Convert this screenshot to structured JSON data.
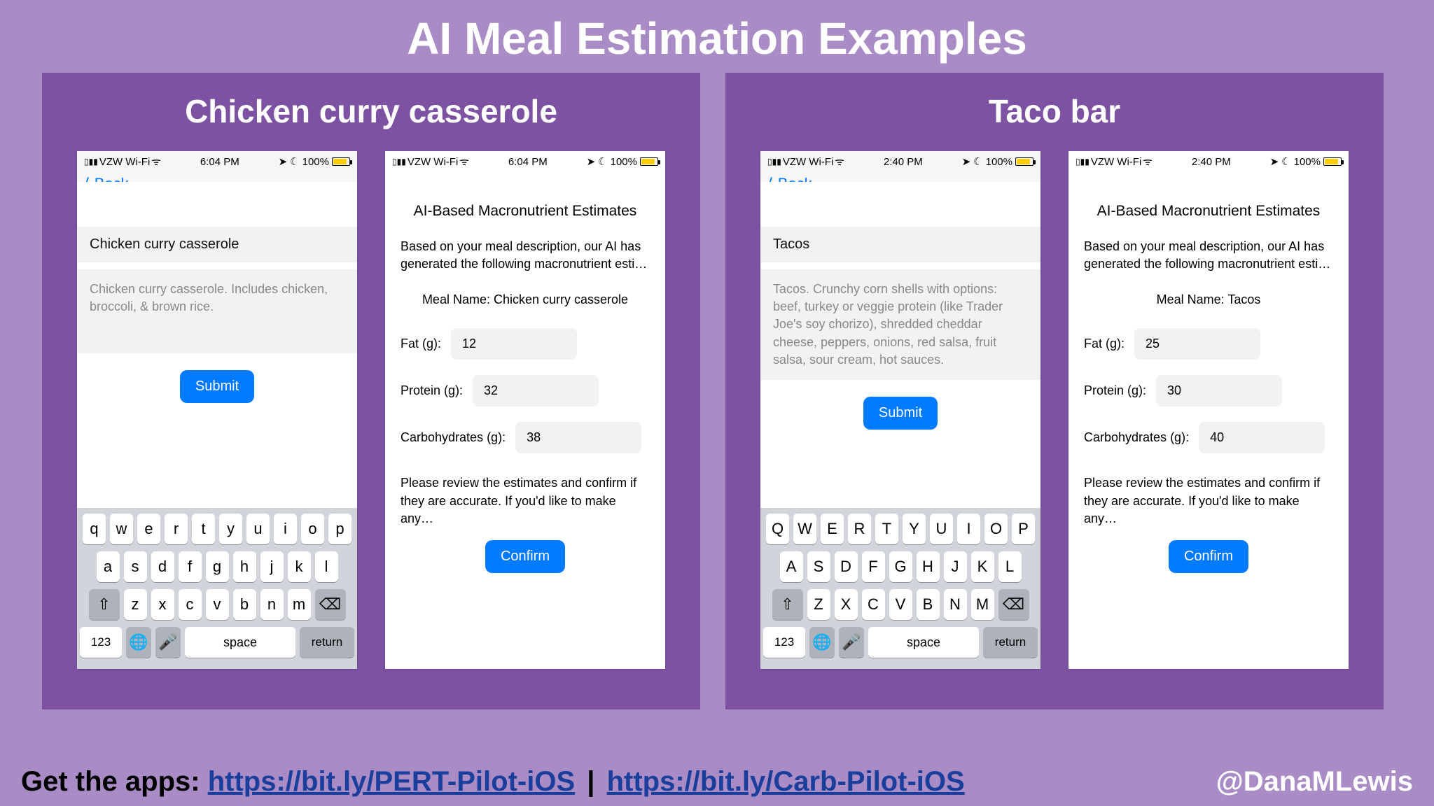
{
  "title": "AI Meal Estimation Examples",
  "panels": [
    {
      "heading": "Chicken curry casserole",
      "input": {
        "status_time": "6:04 PM",
        "status_carrier": "VZW Wi-Fi",
        "status_batt": "100%",
        "back_peek": "⟨ Back",
        "meal_title": "Chicken curry casserole",
        "meal_desc": "Chicken curry casserole. Includes chicken, broccoli, & brown rice.",
        "submit": "Submit",
        "keyboard_case": "lower"
      },
      "estimate": {
        "status_time": "6:04 PM",
        "status_carrier": "VZW Wi-Fi",
        "status_batt": "100%",
        "heading": "AI-Based Macronutrient Estimates",
        "sub": "Based on your meal description, our AI has generated the following macronutrient esti…",
        "meal_name_label": "Meal Name: Chicken curry casserole",
        "fat_label": "Fat (g):",
        "fat_value": "12",
        "protein_label": "Protein (g):",
        "protein_value": "32",
        "carbs_label": "Carbohydrates (g):",
        "carbs_value": "38",
        "review": "Please review the estimates and confirm if they are accurate. If you'd like to make any…",
        "confirm": "Confirm"
      }
    },
    {
      "heading": "Taco bar",
      "input": {
        "status_time": "2:40 PM",
        "status_carrier": "VZW Wi-Fi",
        "status_batt": "100%",
        "back_peek": "⟨ Back",
        "meal_title": "Tacos",
        "meal_desc": "Tacos. Crunchy corn shells with options: beef, turkey or veggie protein (like Trader Joe's soy chorizo), shredded cheddar cheese, peppers, onions, red salsa, fruit salsa, sour cream, hot sauces.",
        "submit": "Submit",
        "keyboard_case": "upper"
      },
      "estimate": {
        "status_time": "2:40 PM",
        "status_carrier": "VZW Wi-Fi",
        "status_batt": "100%",
        "heading": "AI-Based Macronutrient Estimates",
        "sub": "Based on your meal description, our AI has generated the following macronutrient esti…",
        "meal_name_label": "Meal Name: Tacos",
        "fat_label": "Fat (g):",
        "fat_value": "25",
        "protein_label": "Protein (g):",
        "protein_value": "30",
        "carbs_label": "Carbohydrates (g):",
        "carbs_value": "40",
        "review": "Please review the estimates and confirm if they are accurate. If you'd like to make any…",
        "confirm": "Confirm"
      }
    }
  ],
  "footer": {
    "prefix": "Get the apps: ",
    "link1": "https://bit.ly/PERT-Pilot-iOS",
    "sep": " | ",
    "link2": "https://bit.ly/Carb-Pilot-iOS",
    "handle": "@DanaMLewis"
  },
  "keyboard": {
    "lower": {
      "r1": [
        "q",
        "w",
        "e",
        "r",
        "t",
        "y",
        "u",
        "i",
        "o",
        "p"
      ],
      "r2": [
        "a",
        "s",
        "d",
        "f",
        "g",
        "h",
        "j",
        "k",
        "l"
      ],
      "r3": [
        "z",
        "x",
        "c",
        "v",
        "b",
        "n",
        "m"
      ]
    },
    "upper": {
      "r1": [
        "Q",
        "W",
        "E",
        "R",
        "T",
        "Y",
        "U",
        "I",
        "O",
        "P"
      ],
      "r2": [
        "A",
        "S",
        "D",
        "F",
        "G",
        "H",
        "J",
        "K",
        "L"
      ],
      "r3": [
        "Z",
        "X",
        "C",
        "V",
        "B",
        "N",
        "M"
      ]
    },
    "bottom": {
      "num": "123",
      "space": "space",
      "ret": "return"
    }
  }
}
